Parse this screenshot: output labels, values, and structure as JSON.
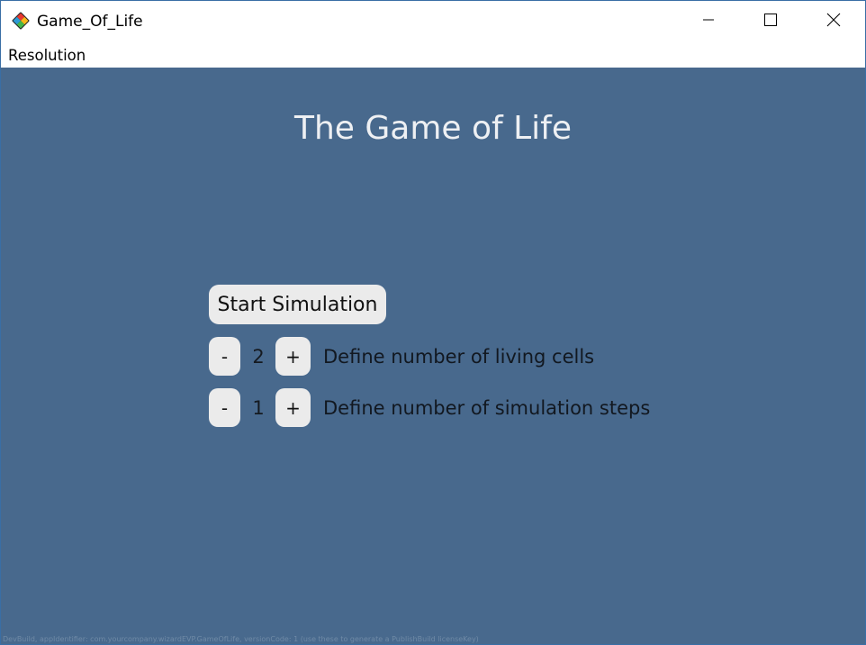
{
  "window": {
    "title": "Game_Of_Life",
    "icon": "app-logo-icon",
    "controls": {
      "minimize": "minimize-icon",
      "maximize": "maximize-icon",
      "close": "close-icon"
    }
  },
  "menu": {
    "items": [
      {
        "label": "Resolution"
      }
    ]
  },
  "main": {
    "title": "The Game of Life",
    "start_button": "Start Simulation",
    "living_cells": {
      "minus": "-",
      "value": "2",
      "plus": "+",
      "label": "Define number of living cells"
    },
    "simulation_steps": {
      "minus": "-",
      "value": "1",
      "plus": "+",
      "label": "Define number of simulation steps"
    },
    "footer": "DevBuild, appIdentifier: com.yourcompany.wizardEVP.GameOfLife, versionCode: 1 (use these to generate a PublishBuild licenseKey)"
  },
  "colors": {
    "background": "#48698d",
    "button": "#ebebeb",
    "title_text": "#eef0f3"
  }
}
